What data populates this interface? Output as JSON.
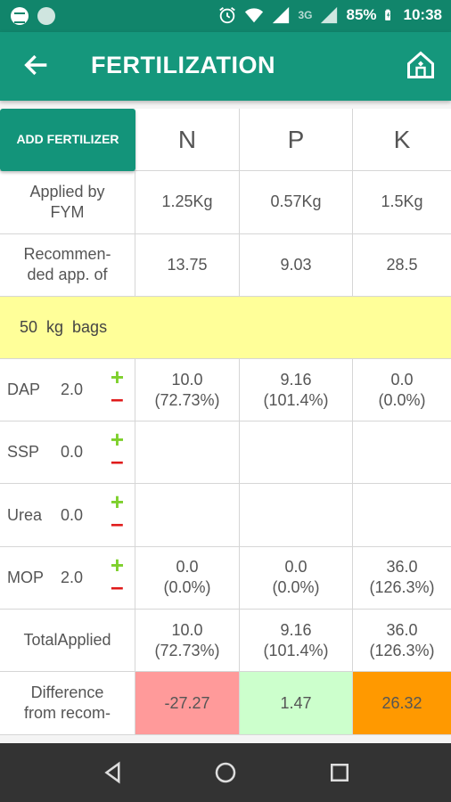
{
  "status": {
    "network": "3G",
    "battery": "85%",
    "time": "10:38"
  },
  "appbar": {
    "title": "FERTILIZATION"
  },
  "table": {
    "add_button": "ADD FERTILIZER",
    "headers": [
      "N",
      "P",
      "K"
    ],
    "applied_fym": {
      "label": "Applied by FYM",
      "values": [
        "1.25Kg",
        "0.57Kg",
        "1.5Kg"
      ]
    },
    "recommended": {
      "label": "Recommen-ded app. of",
      "values": [
        "13.75",
        "9.03",
        "28.5"
      ]
    },
    "bag_banner": "50 kg bags",
    "fertilizers": [
      {
        "name": "DAP",
        "qty": "2.0",
        "values": [
          "10.0\n(72.73%)",
          "9.16\n(101.4%)",
          "0.0\n(0.0%)"
        ]
      },
      {
        "name": "SSP",
        "qty": "0.0",
        "values": [
          "",
          "",
          ""
        ]
      },
      {
        "name": "Urea",
        "qty": "0.0",
        "values": [
          "",
          "",
          ""
        ]
      },
      {
        "name": "MOP",
        "qty": "2.0",
        "values": [
          "0.0\n(0.0%)",
          "0.0\n(0.0%)",
          "36.0\n(126.3%)"
        ]
      }
    ],
    "total": {
      "label": "TotalApplied",
      "values": [
        "10.0\n(72.73%)",
        "9.16\n(101.4%)",
        "36.0\n(126.3%)"
      ]
    },
    "difference": {
      "label": "Difference from recom-",
      "values": [
        "-27.27",
        "1.47",
        "26.32"
      ]
    },
    "colors": {
      "negative": "#ff9a9a",
      "ok": "#ccffcc",
      "excess": "#ff9900"
    }
  },
  "icons": [
    "spotify-icon",
    "status-dot-icon",
    "alarm-icon",
    "wifi-icon",
    "signal-icon",
    "battery-icon",
    "back-arrow-icon",
    "home-icon",
    "nav-back-icon",
    "nav-home-icon",
    "nav-recents-icon"
  ]
}
